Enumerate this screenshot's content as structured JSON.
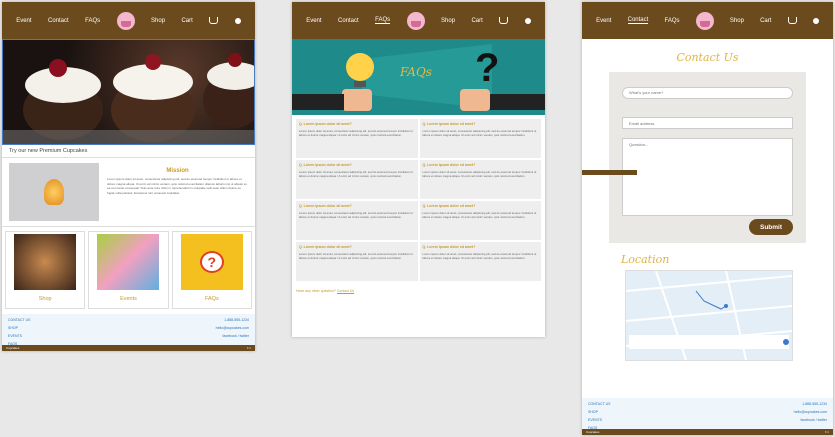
{
  "nav": {
    "event": "Event",
    "contact": "Contact",
    "faqs": "FAQs",
    "shop": "Shop",
    "cart": "Cart"
  },
  "home": {
    "hero_caption": "Try our new Premium Cupcakes",
    "mission_title": "Mission",
    "mission_text": "Lorem ipsum dolor sit amet, consectetur adipiscing elit, sed do eiusmod tempor incididunt ut labore et dolore magna aliqua. Ut enim ad minim veniam, quis nostrud exercitation ullamco laboris nisi ut aliquip ex ea commodo consequat. Duis aute irure dolor in reprehenderit in voluptate velit esse cillum dolore eu fugiat nulla pariatur. Excepteur sint occaecat cupidatat.",
    "cards": [
      "Shop",
      "Events",
      "FAQs"
    ]
  },
  "faq": {
    "banner_title": "FAQs",
    "question": "Q. Lorem Ipsum dolor sit amet?",
    "answer": "Lorem ipsum dolor sit amet, consectetur adipiscing elit, sed do eiusmod tempor incididunt ut labore et dolore magna aliqua. Ut enim ad minim veniam, quis nostrud exercitation.",
    "more_label": "Have any other question?",
    "more_link": "Contact Us"
  },
  "contact": {
    "title": "Contact Us",
    "name_placeholder": "What's your name?",
    "email_placeholder": "Email address",
    "question_placeholder": "Question...",
    "submit": "Submit",
    "location_title": "Location"
  },
  "footer": {
    "left": [
      "CONTACT US",
      "SHOP",
      "EVENTS",
      "FAQS"
    ],
    "right": [
      "1-888-555-1234",
      "hello@cupcakes.com",
      "facebook / twitter"
    ],
    "copyright": "Cupcakes",
    "icons": "f t i"
  },
  "colors": {
    "brown": "#6b4a1e",
    "gold": "#c79a2b",
    "teal": "#1f8a8a"
  }
}
